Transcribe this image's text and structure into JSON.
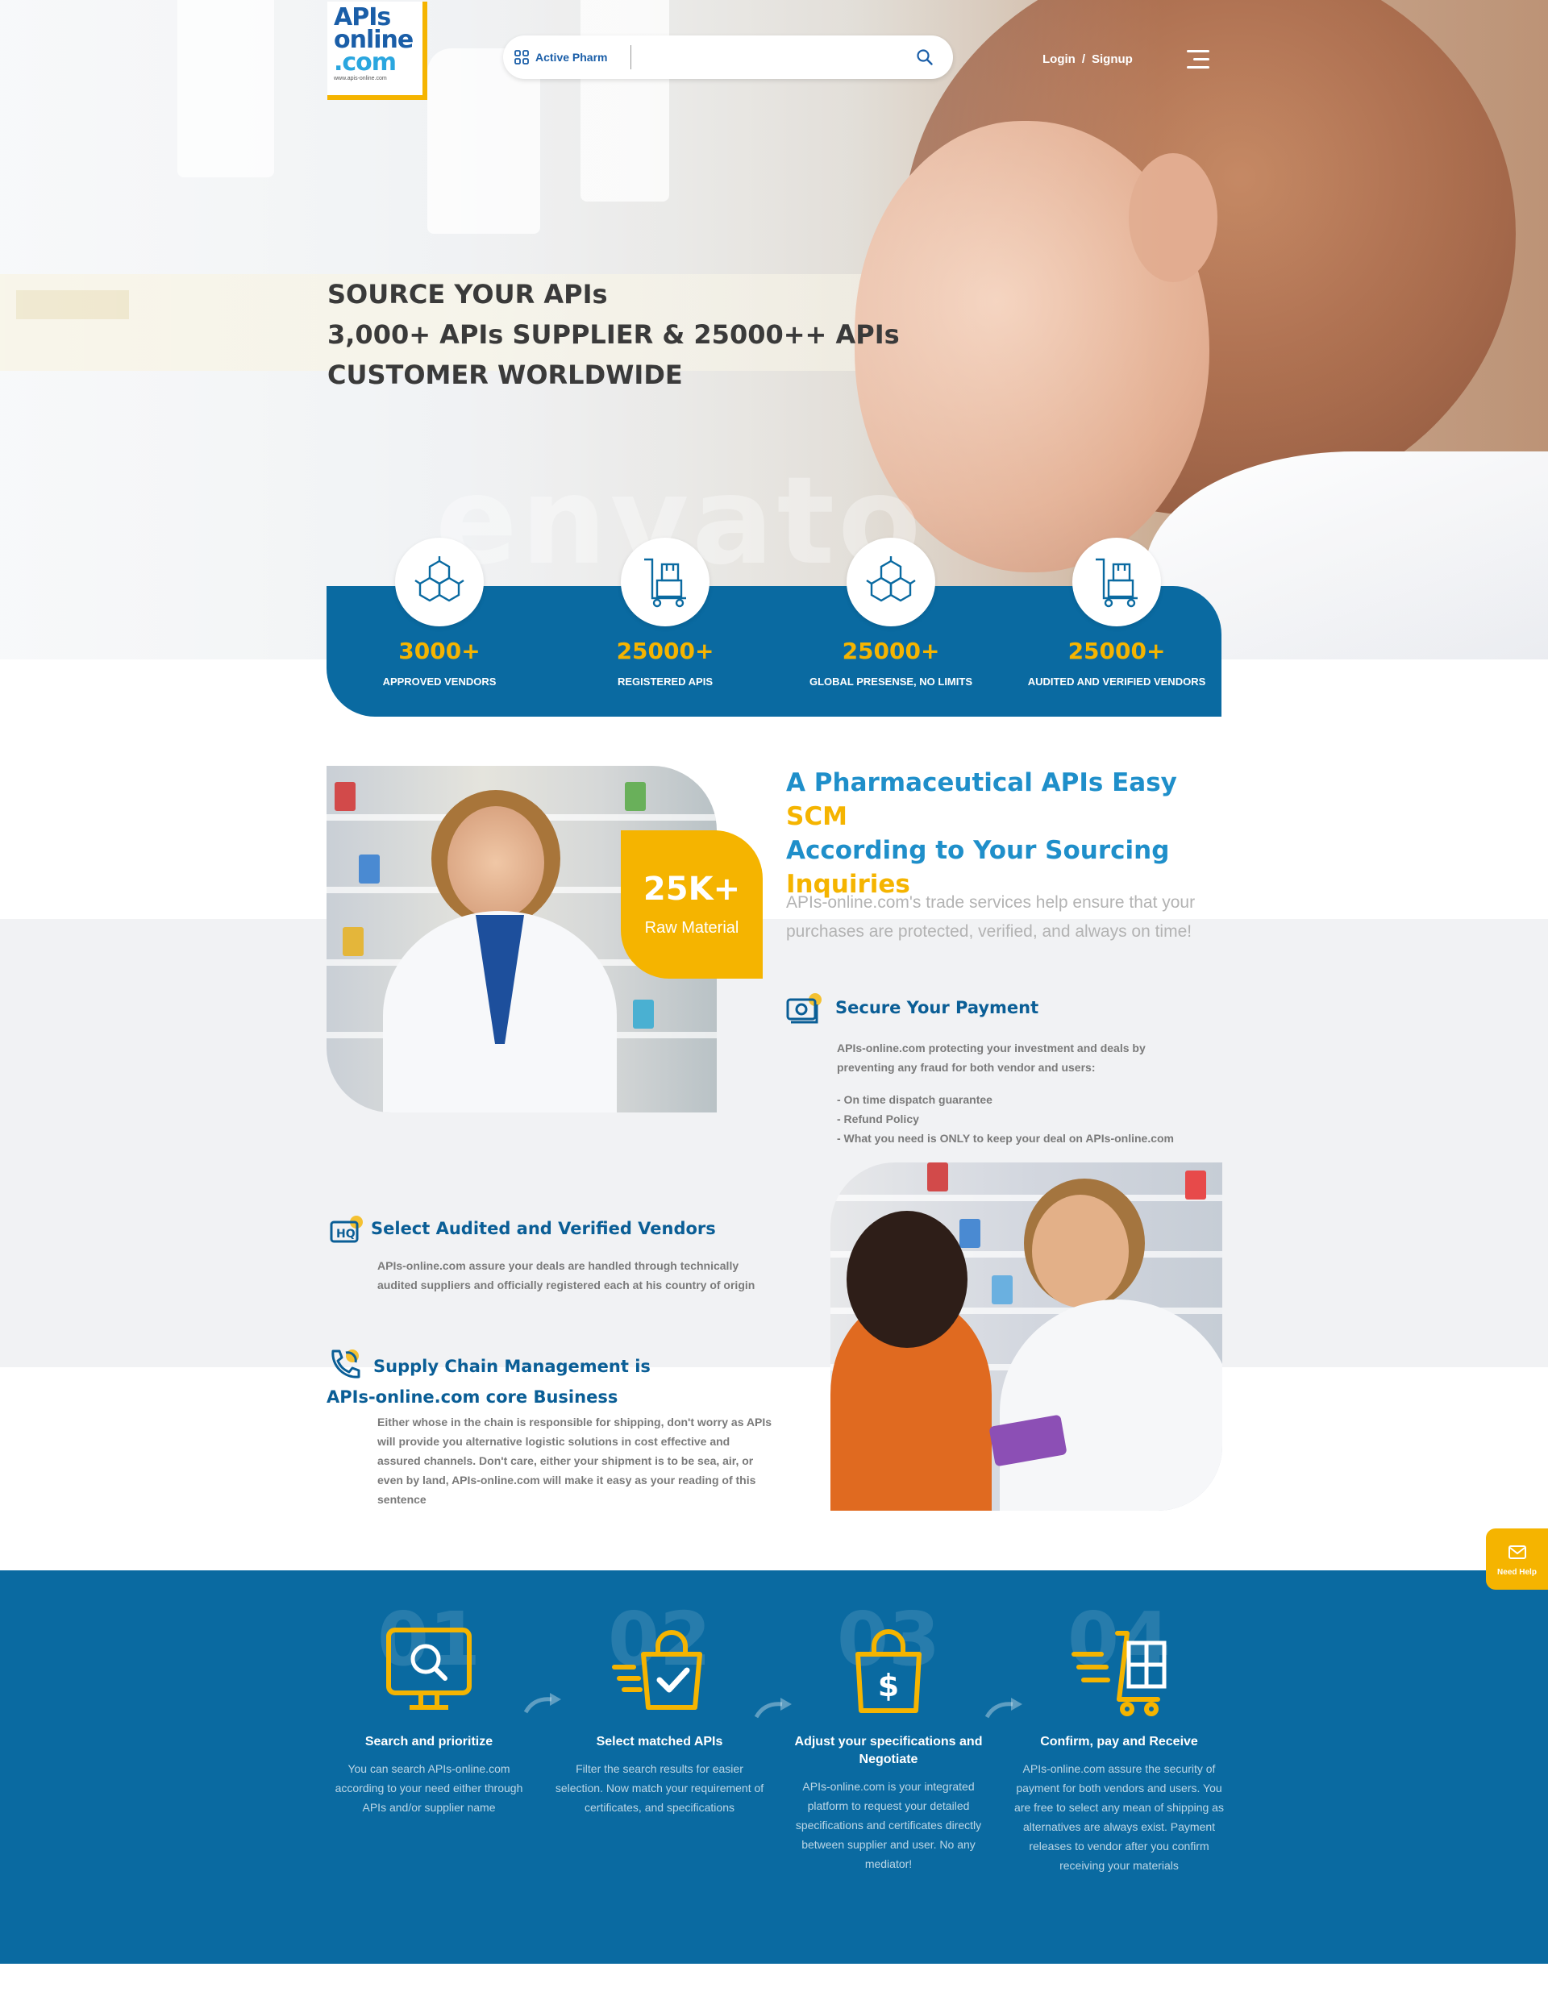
{
  "header": {
    "logo_lines": [
      "APIs",
      "online",
      ".com"
    ],
    "logo_url_text": "www.apis-online.com",
    "search_category": "Active Pharm",
    "search_placeholder": "",
    "login_label": "Login",
    "separator": "/",
    "signup_label": "Signup"
  },
  "hero": {
    "title_lines": [
      "SOURCE YOUR APIs",
      "3,000+ APIs SUPPLIER & 25000++ APIs",
      "CUSTOMER WORLDWIDE"
    ],
    "watermark": "envato"
  },
  "stats": [
    {
      "number": "3000+",
      "label": "APPROVED VENDORS",
      "icon": "molecule-icon"
    },
    {
      "number": "25000+",
      "label": "REGISTERED APIS",
      "icon": "cart-boxes-icon"
    },
    {
      "number": "25000+",
      "label": "GLOBAL PRESENSE, NO LIMITS",
      "icon": "molecule-icon"
    },
    {
      "number": "25000+",
      "label": "AUDITED AND VERIFIED VENDORS",
      "icon": "cart-boxes-icon"
    }
  ],
  "about": {
    "title_part1": "A Pharmaceutical APIs Easy ",
    "title_hl1": "SCM",
    "title_part2": "According to Your Sourcing ",
    "title_hl2": "Inquiries",
    "description": "APIs-online.com's trade services help ensure that your purchases are protected, verified, and always on time!",
    "badge_number": "25K+",
    "badge_label": "Raw Material"
  },
  "features": {
    "payment": {
      "title": "Secure Your Payment",
      "intro": "APIs-online.com protecting your investment and deals by preventing any fraud for both vendor and users:",
      "items": [
        "- On time dispatch guarantee",
        "- Refund Policy",
        "- What you need is ONLY to keep your deal on APIs-online.com"
      ]
    },
    "vendors": {
      "title": "Select Audited and Verified Vendors",
      "text": "APIs-online.com assure your deals are handled through technically audited suppliers and officially registered each at his country of origin"
    },
    "supply": {
      "title": "Supply Chain Management is APIs-online.com core Business",
      "text": "Either whose in the chain is responsible for shipping, don't worry as APIs will provide you alternative logistic solutions in cost effective and assured channels. Don't care, either your shipment is to be sea, air, or even by land, APIs-online.com will make it easy as your reading of this sentence"
    }
  },
  "process": [
    {
      "num": "01",
      "title": "Search and prioritize",
      "text": "You can search APIs-online.com according to your need either through APIs and/or supplier name"
    },
    {
      "num": "02",
      "title": "Select matched APIs",
      "text": "Filter the search results for easier selection. Now match your requirement of certificates, and specifications"
    },
    {
      "num": "03",
      "title": "Adjust your specifications and Negotiate",
      "text": "APIs-online.com is your integrated platform to request your detailed specifications and certificates directly between supplier and user. No any mediator!"
    },
    {
      "num": "04",
      "title": "Confirm, pay and Receive",
      "text": "APIs-online.com assure the security of payment for both vendors and users. You are free to select any mean of shipping as alternatives are always exist. Payment releases to vendor after you confirm receiving your materials"
    }
  ],
  "need_help": "Need Help",
  "colors": {
    "primary_blue": "#0a6aa1",
    "accent_yellow": "#f5b400",
    "title_blue": "#1f8fca"
  }
}
